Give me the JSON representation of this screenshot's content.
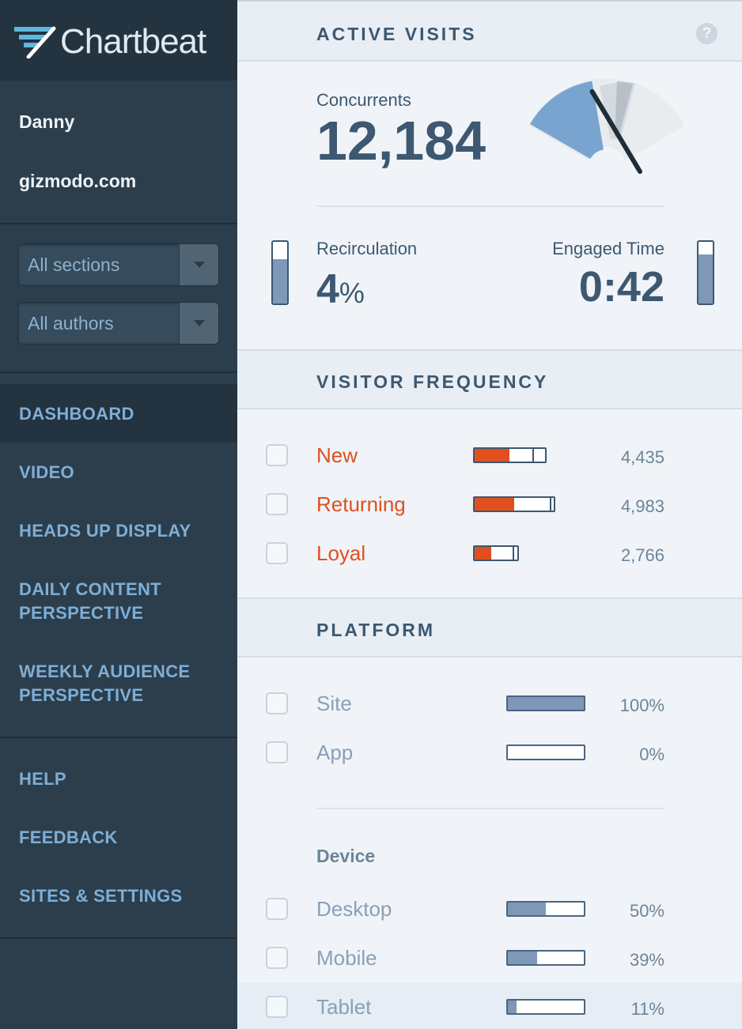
{
  "app": {
    "name": "Chartbeat"
  },
  "account": {
    "user": "Danny",
    "site": "gizmodo.com"
  },
  "filters": {
    "sections": "All sections",
    "authors": "All authors"
  },
  "nav": {
    "dashboard": "DASHBOARD",
    "video": "VIDEO",
    "heads_up": "HEADS UP DISPLAY",
    "daily_line1": "DAILY CONTENT",
    "daily_line2": "PERSPECTIVE",
    "weekly_line1": "WEEKLY AUDIENCE",
    "weekly_line2": "PERSPECTIVE",
    "help": "HELP",
    "feedback": "FEEDBACK",
    "settings": "SITES & SETTINGS"
  },
  "active_visits": {
    "title": "ACTIVE VISITS",
    "help_symbol": "?",
    "concurrents_label": "Concurrents",
    "concurrents_value": "12,184",
    "gauge_fraction": 0.42,
    "recirculation_label": "Recirculation",
    "recirculation_value": "4",
    "recirculation_unit": "%",
    "recirculation_level": 0.72,
    "engaged_label": "Engaged Time",
    "engaged_value": "0:42",
    "engaged_level": 0.8
  },
  "visitor_frequency": {
    "title": "VISITOR FREQUENCY",
    "color": "#e0501f",
    "rows": [
      {
        "label": "New",
        "value": "4,435",
        "fill": 0.49,
        "mark": 0.82
      },
      {
        "label": "Returning",
        "value": "4,983",
        "fill": 0.5,
        "mark": 0.95
      },
      {
        "label": "Loyal",
        "value": "2,766",
        "fill": 0.39,
        "mark": 0.88
      }
    ]
  },
  "platform": {
    "title": "PLATFORM",
    "rows": [
      {
        "label": "Site",
        "value": "100%",
        "fill": 1.0
      },
      {
        "label": "App",
        "value": "0%",
        "fill": 0.0
      }
    ],
    "device_title": "Device",
    "devices": [
      {
        "label": "Desktop",
        "value": "50%",
        "fill": 0.5
      },
      {
        "label": "Mobile",
        "value": "39%",
        "fill": 0.39
      },
      {
        "label": "Tablet",
        "value": "11%",
        "fill": 0.11
      }
    ]
  }
}
